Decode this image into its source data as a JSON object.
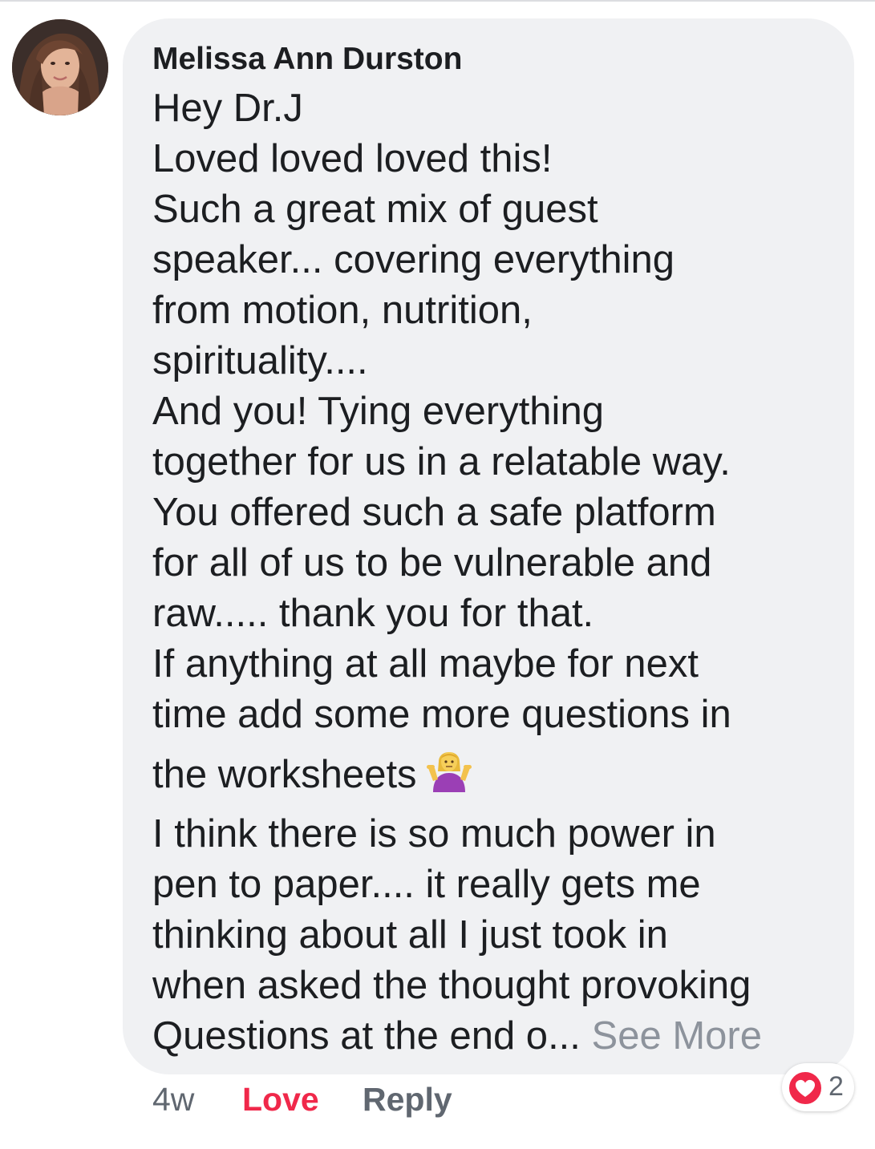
{
  "comment": {
    "author": "Melissa Ann Durston",
    "lines": [
      "Hey Dr.J",
      "Loved loved loved this!",
      "Such a great mix of guest",
      "speaker... covering everything",
      "from motion, nutrition,",
      "spirituality....",
      "And you! Tying everything",
      "together for us in a relatable way.",
      "You offered such a safe platform",
      "for all of us to be vulnerable and",
      "raw..... thank you for that.",
      "If anything at all maybe for next",
      "time add some more questions in",
      "the worksheets",
      "I think there is so much power in",
      "pen to paper.... it really gets me",
      "thinking about all I just took in",
      "when asked the thought provoking",
      "Questions at the end o..."
    ],
    "emoji": "person-shrugging-emoji",
    "see_more": "See More"
  },
  "actions": {
    "time": "4w",
    "love": "Love",
    "reply": "Reply"
  },
  "reactions": {
    "icon": "heart-icon",
    "count": "2"
  },
  "colors": {
    "bubble": "#f0f1f3",
    "text": "#1c1e21",
    "secondary": "#606770",
    "see_more": "#8d939c",
    "love": "#f0284a"
  }
}
